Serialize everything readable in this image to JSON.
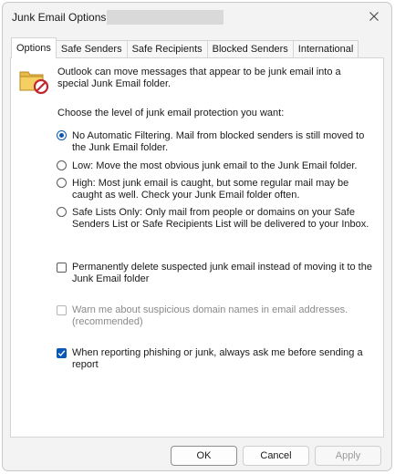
{
  "window": {
    "title": "Junk Email Options"
  },
  "tabs": [
    {
      "label": "Options",
      "active": true
    },
    {
      "label": "Safe Senders",
      "active": false
    },
    {
      "label": "Safe Recipients",
      "active": false
    },
    {
      "label": "Blocked Senders",
      "active": false
    },
    {
      "label": "International",
      "active": false
    }
  ],
  "intro_text": "Outlook can move messages that appear to be junk email into a special Junk Email folder.",
  "level_prompt": "Choose the level of junk email protection you want:",
  "levels": [
    {
      "label": "No Automatic Filtering. Mail from blocked senders is still moved to the Junk Email folder.",
      "selected": true
    },
    {
      "label": "Low: Move the most obvious junk email to the Junk Email folder.",
      "selected": false
    },
    {
      "label": "High: Most junk email is caught, but some regular mail may be caught as well. Check your Junk Email folder often.",
      "selected": false
    },
    {
      "label": "Safe Lists Only: Only mail from people or domains on your Safe Senders List or Safe Recipients List will be delivered to your Inbox.",
      "selected": false
    }
  ],
  "checkboxes": {
    "delete_junk": {
      "label": "Permanently delete suspected junk email instead of moving it to the Junk Email folder",
      "checked": false,
      "enabled": true
    },
    "warn_domains": {
      "label": "Warn me about suspicious domain names in email addresses. (recommended)",
      "checked": false,
      "enabled": false
    },
    "ask_phishing": {
      "label": "When reporting phishing or junk, always ask me before sending a report",
      "checked": true,
      "enabled": true
    }
  },
  "buttons": {
    "ok": "OK",
    "cancel": "Cancel",
    "apply": "Apply"
  },
  "colors": {
    "accent": "#0a58b5",
    "window_bg": "#f3f3f3",
    "panel_bg": "#ffffff"
  },
  "icons": {
    "close": "close-icon",
    "junk_folder": "junk-folder-icon",
    "checkmark": "checkmark-icon"
  }
}
